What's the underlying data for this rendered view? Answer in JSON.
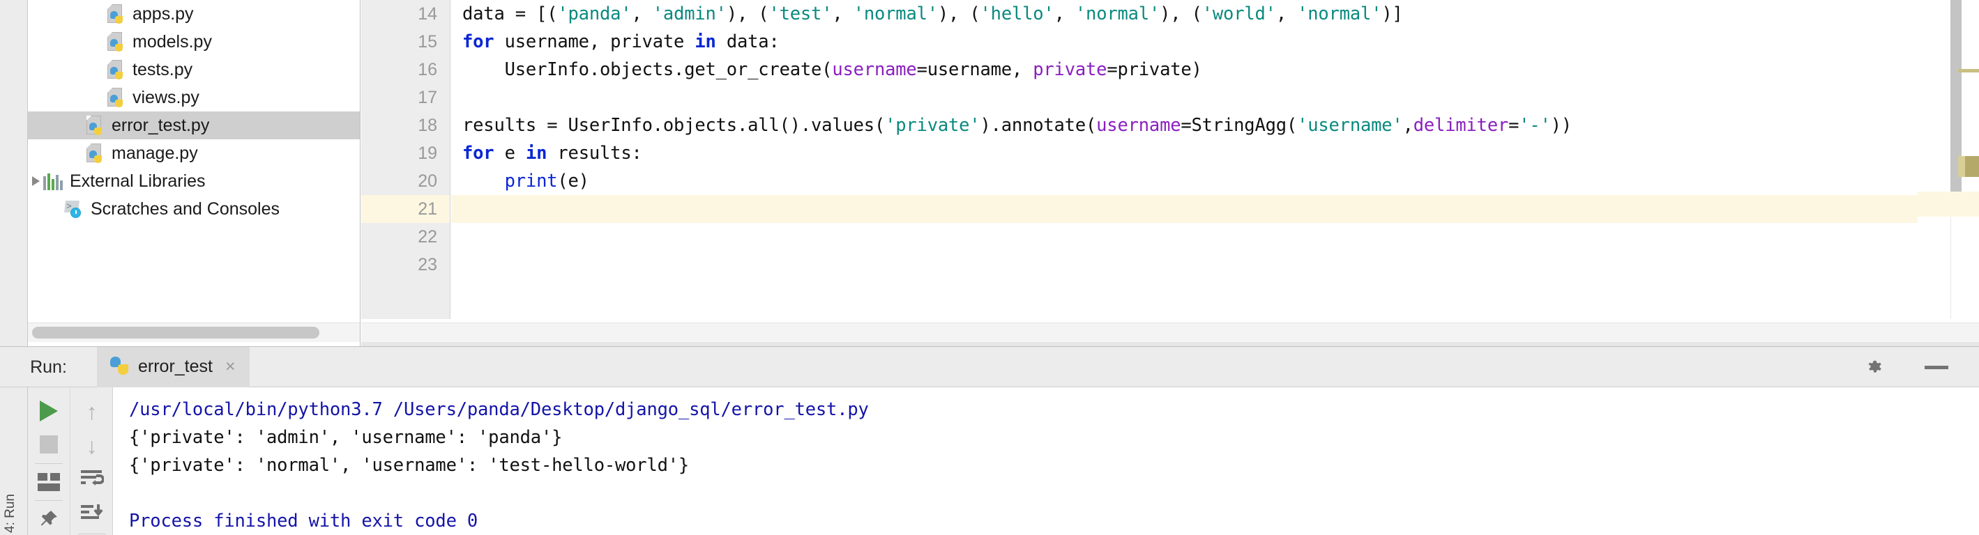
{
  "sidebar": {
    "name": "project-tree",
    "items": [
      {
        "label": "apps.py",
        "icon": "python-file-icon",
        "indent": 112,
        "arrow": "none",
        "selected": false
      },
      {
        "label": "models.py",
        "icon": "python-file-icon",
        "indent": 112,
        "arrow": "none",
        "selected": false
      },
      {
        "label": "tests.py",
        "icon": "python-file-icon",
        "indent": 112,
        "arrow": "none",
        "selected": false
      },
      {
        "label": "views.py",
        "icon": "python-file-icon",
        "indent": 112,
        "arrow": "none",
        "selected": false
      },
      {
        "label": "error_test.py",
        "icon": "python-file-icon",
        "indent": 82,
        "arrow": "none",
        "selected": true
      },
      {
        "label": "manage.py",
        "icon": "python-file-icon",
        "indent": 82,
        "arrow": "none",
        "selected": false
      },
      {
        "label": "External Libraries",
        "icon": "libraries-icon",
        "indent": 22,
        "arrow": "closed",
        "selected": false
      },
      {
        "label": "Scratches and Consoles",
        "icon": "scratches-icon",
        "indent": 52,
        "arrow": "none",
        "selected": false
      }
    ]
  },
  "editor": {
    "name": "code-editor",
    "active_line": 21,
    "lines": [
      {
        "num": "14",
        "tokens": [
          {
            "t": "data = [(",
            "c": "plain"
          },
          {
            "t": "'panda'",
            "c": "str"
          },
          {
            "t": ", ",
            "c": "plain"
          },
          {
            "t": "'admin'",
            "c": "str"
          },
          {
            "t": "), (",
            "c": "plain"
          },
          {
            "t": "'test'",
            "c": "str"
          },
          {
            "t": ", ",
            "c": "plain"
          },
          {
            "t": "'normal'",
            "c": "str"
          },
          {
            "t": "), (",
            "c": "plain"
          },
          {
            "t": "'hello'",
            "c": "str"
          },
          {
            "t": ", ",
            "c": "plain"
          },
          {
            "t": "'normal'",
            "c": "str"
          },
          {
            "t": "), (",
            "c": "plain"
          },
          {
            "t": "'world'",
            "c": "str"
          },
          {
            "t": ", ",
            "c": "plain"
          },
          {
            "t": "'normal'",
            "c": "str"
          },
          {
            "t": ")]",
            "c": "plain"
          }
        ]
      },
      {
        "num": "15",
        "tokens": [
          {
            "t": "for",
            "c": "kw"
          },
          {
            "t": " username, private ",
            "c": "plain"
          },
          {
            "t": "in",
            "c": "kw"
          },
          {
            "t": " data:",
            "c": "plain"
          }
        ]
      },
      {
        "num": "16",
        "tokens": [
          {
            "t": "    UserInfo.objects.get_or_create(",
            "c": "plain"
          },
          {
            "t": "username",
            "c": "kwarg"
          },
          {
            "t": "=username, ",
            "c": "plain"
          },
          {
            "t": "private",
            "c": "kwarg"
          },
          {
            "t": "=private)",
            "c": "plain"
          }
        ]
      },
      {
        "num": "17",
        "tokens": []
      },
      {
        "num": "18",
        "tokens": [
          {
            "t": "results = UserInfo.objects.all().values(",
            "c": "plain"
          },
          {
            "t": "'private'",
            "c": "str"
          },
          {
            "t": ").annotate(",
            "c": "plain"
          },
          {
            "t": "username",
            "c": "kwarg"
          },
          {
            "t": "=StringAgg(",
            "c": "plain"
          },
          {
            "t": "'username'",
            "c": "str"
          },
          {
            "t": ",",
            "c": "plain"
          },
          {
            "t": "delimiter",
            "c": "kwarg"
          },
          {
            "t": "=",
            "c": "plain"
          },
          {
            "t": "'-'",
            "c": "str"
          },
          {
            "t": "))",
            "c": "plain"
          }
        ]
      },
      {
        "num": "19",
        "tokens": [
          {
            "t": "for",
            "c": "kw"
          },
          {
            "t": " e ",
            "c": "plain"
          },
          {
            "t": "in",
            "c": "kw"
          },
          {
            "t": " results:",
            "c": "plain"
          }
        ]
      },
      {
        "num": "20",
        "tokens": [
          {
            "t": "    ",
            "c": "plain"
          },
          {
            "t": "print",
            "c": "blu"
          },
          {
            "t": "(e)",
            "c": "plain"
          }
        ]
      },
      {
        "num": "21",
        "tokens": []
      },
      {
        "num": "22",
        "tokens": []
      },
      {
        "num": "23",
        "tokens": []
      }
    ]
  },
  "run_window": {
    "name": "run-tool-window",
    "label": "Run:",
    "tab": {
      "title": "error_test",
      "icon": "python-icon",
      "close": "×"
    },
    "header_icons": [
      {
        "name": "gear-icon"
      },
      {
        "name": "minimize-icon"
      }
    ],
    "toolbar": {
      "left": [
        {
          "name": "rerun-button",
          "icon": "play-icon"
        },
        {
          "name": "stop-button",
          "icon": "stop-icon"
        },
        {
          "name": "toggle-tasks-button",
          "icon": "layout-icon"
        },
        {
          "name": "pin-tab-button",
          "icon": "pin-icon"
        }
      ],
      "right": [
        {
          "name": "up-stack-trace-button",
          "icon": "arrow-up-icon",
          "glyph": "↑"
        },
        {
          "name": "down-stack-trace-button",
          "icon": "arrow-down-icon",
          "glyph": "↓"
        },
        {
          "name": "soft-wrap-button",
          "icon": "soft-wrap-icon"
        },
        {
          "name": "scroll-to-end-button",
          "icon": "scroll-to-end-icon"
        }
      ]
    },
    "rail_label": "4: Run",
    "console": {
      "name": "console-output",
      "lines": [
        {
          "text": "/usr/local/bin/python3.7 /Users/panda/Desktop/django_sql/error_test.py",
          "color": "navy"
        },
        {
          "text": "{'private': 'admin', 'username': 'panda'}",
          "color": "black"
        },
        {
          "text": "{'private': 'normal', 'username': 'test-hello-world'}",
          "color": "black"
        },
        {
          "text": "",
          "color": "black"
        },
        {
          "text": "Process finished with exit code 0",
          "color": "navy"
        }
      ]
    }
  },
  "colors": {
    "keyword": "#0a26d4",
    "string": "#0a8a7f",
    "kwarg": "#8a1fbf",
    "console_navy": "#1414a8",
    "selection": "#cfcfcf",
    "current_line": "#fdf7e2",
    "run_play": "#4c9a4c"
  }
}
